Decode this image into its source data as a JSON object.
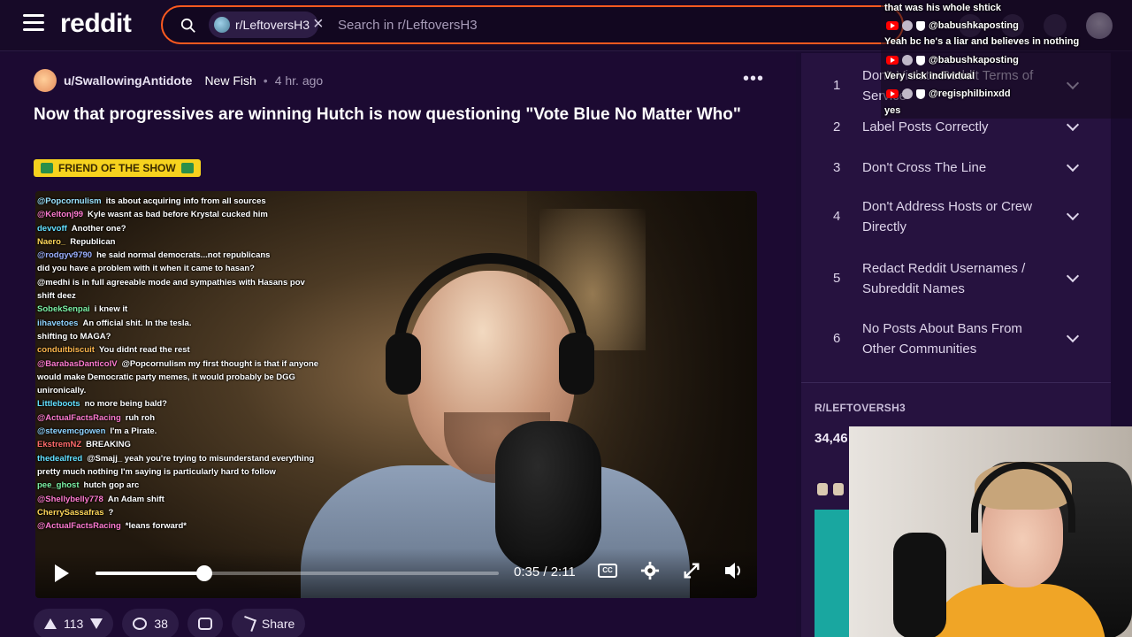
{
  "header": {
    "logo_text": "reddit",
    "search_chip": "r/LeftoversH3",
    "search_chip_close": "×",
    "search_placeholder": "Search in r/LeftoversH3"
  },
  "post": {
    "author": "u/SwallowingAntidote",
    "author_flair": "New Fish",
    "separator": "•",
    "age": "4 hr. ago",
    "menu": "•••",
    "title": "Now that progressives are winning Hutch is now questioning \"Vote Blue No Matter Who\"",
    "flair": "FRIEND OF THE SHOW",
    "upvotes": "113",
    "comments": "38",
    "share_label": "Share"
  },
  "video": {
    "time": "0:35 / 2:11",
    "progress_fraction": 0.27,
    "cc_label": "CC",
    "chat": [
      {
        "user": "@Popcornulism",
        "text": "its about acquiring info from all sources",
        "color": "#9be3ff"
      },
      {
        "user": "@Keltonj99",
        "text": "Kyle wasnt as bad before Krystal cucked him",
        "color": "#ff7bd0"
      },
      {
        "user": "devvoff",
        "text": "Another one?",
        "color": "#63e0ff"
      },
      {
        "user": "Naero_",
        "text": "Republican",
        "color": "#ffd75a"
      },
      {
        "user": "@rodgyv9790",
        "text": "he said normal democrats...not republicans",
        "color": "#9bb0ff"
      },
      {
        "user": "",
        "text": "did you have a problem with it when it came to hasan?",
        "color": "#ff6b6b",
        "wrap": true
      },
      {
        "user": "",
        "text": "@medhi is in full agreeable mode and sympathies with Hasans pov",
        "color": "#ff6b6b",
        "wrap": true
      },
      {
        "user": "",
        "text": "shift deez",
        "color": "#ff6b6b"
      },
      {
        "user": "SobekSenpai",
        "text": "i knew it",
        "color": "#7cf2a5"
      },
      {
        "user": "iihavetoes",
        "text": "An official shit. In the tesla.",
        "color": "#8fd3ff"
      },
      {
        "user": "",
        "text": "shifting to MAGA?",
        "color": "#c59bff"
      },
      {
        "user": "conduitbiscuit",
        "text": "You didnt read the rest",
        "color": "#ffb74d"
      },
      {
        "user": "@BarabasDanticoIV",
        "text": "@Popcornulism my first thought is that if anyone would make Democratic party memes, it would probably be DGG unironically.",
        "color": "#ff7bd0",
        "wrap": true
      },
      {
        "user": "Littleboots",
        "text": "no more being bald?",
        "color": "#63e0ff"
      },
      {
        "user": "@ActualFactsRacing",
        "text": "ruh roh",
        "color": "#ff7bd0"
      },
      {
        "user": "@stevemcgowen",
        "text": "I'm a Pirate.",
        "color": "#8fd3ff"
      },
      {
        "user": "EkstremNZ",
        "text": "BREAKING",
        "color": "#ff6b6b"
      },
      {
        "user": "thedealfred",
        "text": "@Smajj_ yeah you're trying to misunderstand everything pretty much nothing I'm saying is particularly hard to follow",
        "color": "#63e0ff",
        "wrap": true
      },
      {
        "user": "pee_ghost",
        "text": "hutch gop arc",
        "color": "#7cf2a5"
      },
      {
        "user": "@Shellybelly778",
        "text": "An Adam shift",
        "color": "#ff7bd0"
      },
      {
        "user": "CherrySassafras",
        "text": "?",
        "color": "#ffd75a"
      },
      {
        "user": "@ActualFactsRacing",
        "text": "*leans forward*",
        "color": "#ff7bd0"
      }
    ]
  },
  "sidebar": {
    "rules": [
      {
        "num": "1",
        "text": "Don't Violate Reddit Terms of Service"
      },
      {
        "num": "2",
        "text": "Label Posts Correctly"
      },
      {
        "num": "3",
        "text": "Don't Cross The Line"
      },
      {
        "num": "4",
        "text": "Don't Address Hosts or Crew Directly"
      },
      {
        "num": "5",
        "text": "Redact Reddit Usernames / Subreddit Names"
      },
      {
        "num": "6",
        "text": "No Posts About Bans From Other Communities"
      }
    ],
    "community_label": "R/LEFTOVERSH3",
    "member_count": "34,46"
  },
  "overlay": {
    "lines": [
      {
        "type": "text",
        "text": "that was his whole shtick"
      },
      {
        "type": "user",
        "text": "@babushkaposting"
      },
      {
        "type": "text",
        "text": "Yeah bc he's a liar and believes in nothing"
      },
      {
        "type": "user",
        "text": "@babushkaposting"
      },
      {
        "type": "text",
        "text": "Very sick individual"
      },
      {
        "type": "user",
        "text": "@regisphilbinxdd"
      },
      {
        "type": "text",
        "text": "yes"
      }
    ]
  },
  "colors": {
    "brand": "#ff4500",
    "search_border": "#ff5a1f",
    "background": "#1a0b30",
    "flair": "#f6d21e"
  }
}
